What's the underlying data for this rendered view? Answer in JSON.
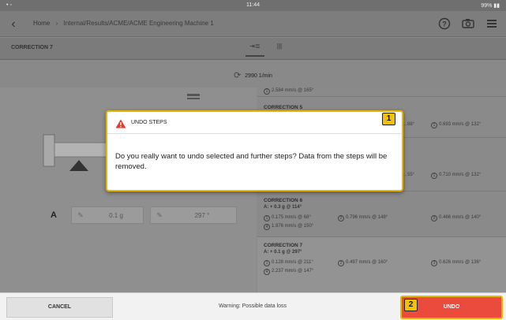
{
  "status_bar": {
    "left": "•  ◦",
    "time": "11:44",
    "right": "99% ▮▮"
  },
  "header": {
    "back_icon": "chevron-left-icon",
    "home": "Home",
    "separator": "›",
    "path": "Internal/Results/ACME/ACME Engineering Machine 1",
    "icons": [
      "help-icon",
      "camera-icon",
      "menu-icon"
    ]
  },
  "tabrow": {
    "title": "CORRECTION 7",
    "tabs": [
      "⇥≣",
      "|||"
    ]
  },
  "rpm": {
    "icon": "⟳",
    "value": "2990 1/min"
  },
  "left": {
    "row_label": "A",
    "field1_value": "0.1 g",
    "field2_value": "297 °",
    "pen": "✎"
  },
  "list": {
    "partial_top": "2.584 mm/s @ 165°",
    "items": [
      {
        "name": "CORRECTION 5",
        "line1a": "…88°",
        "line1b": "0.693 mm/s @ 132°"
      },
      {
        "name": "",
        "line1a": "…55°",
        "line1b": "0.710 mm/s @ 132°"
      },
      {
        "name": "CORRECTION 6",
        "val": "A: + 0.3 g @ 114°",
        "line1": "0.175 mm/s @ 68°",
        "line1b": "0.796 mm/s @ 148°",
        "line1c": "0.466 mm/s @ 140°",
        "line2": "1.976 mm/s @ 150°"
      },
      {
        "name": "CORRECTION 7",
        "val": "A: + 0.1 g @ 297°",
        "line1": "0.128 mm/s @ 211°",
        "line1b": "0.497 mm/s @ 160°",
        "line1c": "0.626 mm/s @ 136°",
        "line2": "2.237 mm/s @ 147°"
      }
    ],
    "circle_labels": [
      "1",
      "2",
      "3",
      "4"
    ]
  },
  "modal": {
    "title": "UNDO STEPS",
    "message": "Do you really want to undo selected and further steps? Data from the steps will be removed."
  },
  "markers": {
    "m1": "1",
    "m2": "2"
  },
  "bottom": {
    "cancel": "CANCEL",
    "warning": "Warning: Possible data loss",
    "undo": "UNDO"
  },
  "colors": {
    "accent_red": "#ea4b3d",
    "highlight_yellow": "#e8b800",
    "overlay": "#8a8a8a"
  }
}
